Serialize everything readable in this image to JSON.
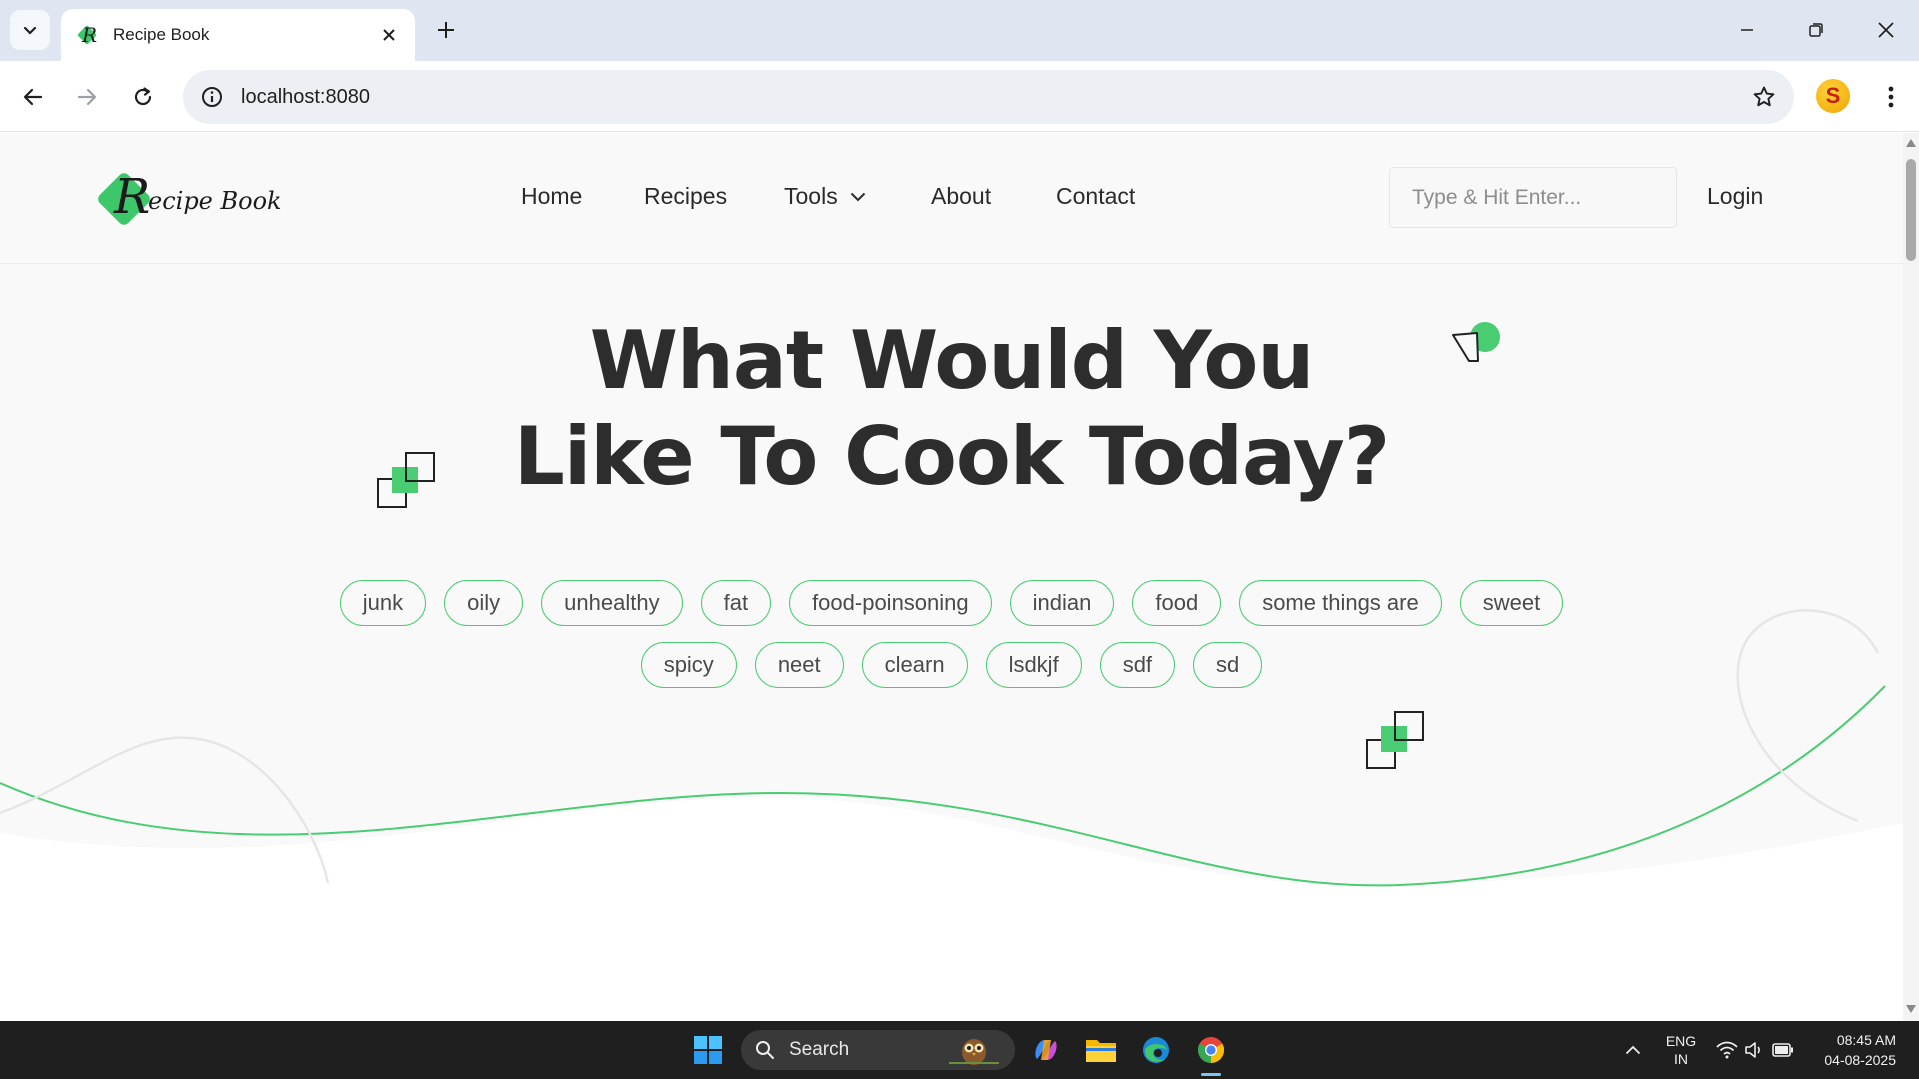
{
  "browser": {
    "tab_title": "Recipe Book",
    "url": "localhost:8080"
  },
  "navbar": {
    "logo_text": "ecipe Book",
    "logo_letter": "R",
    "links": {
      "home": "Home",
      "recipes": "Recipes",
      "tools": "Tools",
      "about": "About",
      "contact": "Contact"
    },
    "search_placeholder": "Type & Hit Enter...",
    "login": "Login"
  },
  "hero": {
    "title_line1": "What Would You",
    "title_line2": "Like To Cook Today?",
    "tags": [
      "junk",
      "oily",
      "unhealthy",
      "fat",
      "food-poinsoning",
      "indian",
      "food",
      "some things are",
      "sweet",
      "spicy",
      "neet",
      "clearn",
      "lsdkjf",
      "sdf",
      "sd"
    ]
  },
  "taskbar": {
    "search_label": "Search",
    "lang_line1": "ENG",
    "lang_line2": "IN",
    "time": "08:45 AM",
    "date": "04-08-2025"
  },
  "colors": {
    "accent": "#49cc72",
    "title": "#2d2d2d",
    "taskbar": "#1f1f1f"
  }
}
